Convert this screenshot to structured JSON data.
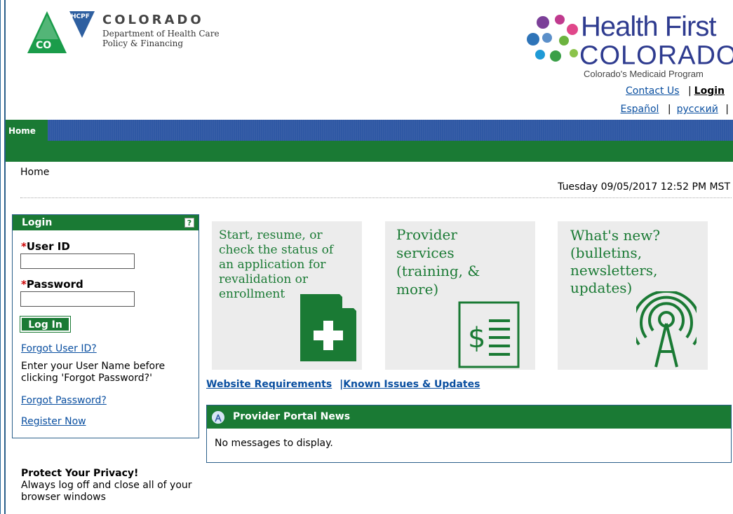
{
  "header": {
    "state_name": "COLORADO",
    "dept_line1": "Department of Health Care",
    "dept_line2": "Policy & Financing",
    "hcpf_badge": "HCPF",
    "co_badge": "CO",
    "hfc_title": "Health First",
    "hfc_sub": "COLORADO",
    "hfc_tm": "™",
    "hfc_tagline": "Colorado's Medicaid Program",
    "contact_link": "Contact Us",
    "sep": "|",
    "login_link": "Login",
    "lang_espanol": "Español",
    "lang_russian": "русский"
  },
  "nav": {
    "home_tab": "Home"
  },
  "breadcrumb": "Home",
  "datetime": "Tuesday 09/05/2017 12:52 PM MST",
  "login": {
    "title": "Login",
    "help": "?",
    "required_mark": "*",
    "user_id_label": "User ID",
    "user_id_value": "",
    "password_label": "Password",
    "password_value": "",
    "login_button": "Log In",
    "forgot_user_id": "Forgot User ID?",
    "note": "Enter your User Name before clicking 'Forgot Password?'",
    "forgot_password": "Forgot Password?",
    "register": "Register Now"
  },
  "privacy": {
    "title": "Protect Your Privacy!",
    "text": "Always log off and close all of your browser windows"
  },
  "tiles": [
    {
      "lines": [
        "Start, resume, or",
        "check the status of",
        "an application for",
        "revalidation or",
        "enrollment"
      ],
      "icon": "document-plus-icon"
    },
    {
      "lines": [
        "Provider",
        "services",
        "(training, &",
        "more)"
      ],
      "icon": "dollar-list-icon"
    },
    {
      "lines": [
        "What's new?",
        "(bulletins,",
        "newsletters,",
        "updates)"
      ],
      "icon": "broadcast-tower-icon"
    }
  ],
  "links": {
    "website_requirements": "Website Requirements",
    "sep": "|",
    "known_issues": "Known Issues & Updates"
  },
  "news": {
    "title": "Provider Portal News",
    "message": "No messages to display."
  },
  "colors": {
    "green": "#1a7a34",
    "blue_nav": "#2f58a4",
    "link": "#0a4fa0",
    "hfc_blue": "#2e3b8f"
  }
}
